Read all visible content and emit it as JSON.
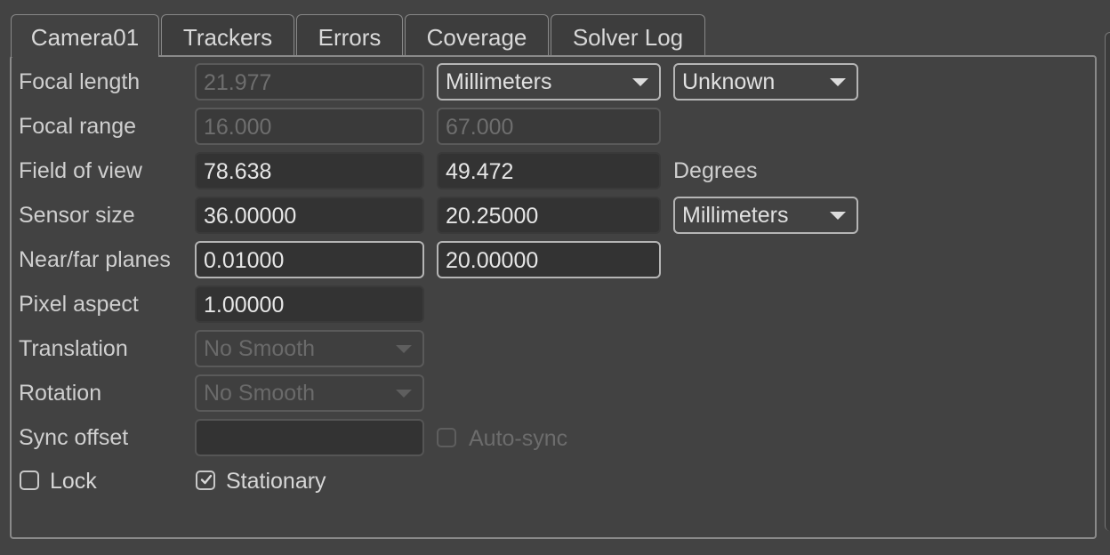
{
  "tabs": [
    {
      "label": "Camera01"
    },
    {
      "label": "Trackers"
    },
    {
      "label": "Errors"
    },
    {
      "label": "Coverage"
    },
    {
      "label": "Solver Log"
    }
  ],
  "rows": {
    "focal_length": {
      "label": "Focal length",
      "value": "21.977",
      "unit": "Millimeters",
      "mode": "Unknown"
    },
    "focal_range": {
      "label": "Focal range",
      "min": "16.000",
      "max": "67.000"
    },
    "field_of_view": {
      "label": "Field of view",
      "h": "78.638",
      "v": "49.472",
      "unit": "Degrees"
    },
    "sensor_size": {
      "label": "Sensor size",
      "w": "36.00000",
      "h": "20.25000",
      "unit": "Millimeters"
    },
    "near_far": {
      "label": "Near/far planes",
      "near": "0.01000",
      "far": "20.00000"
    },
    "pixel_aspect": {
      "label": "Pixel aspect",
      "value": "1.00000"
    },
    "translation": {
      "label": "Translation",
      "value": "No Smooth"
    },
    "rotation": {
      "label": "Rotation",
      "value": "No Smooth"
    },
    "sync_offset": {
      "label": "Sync offset",
      "value": "",
      "auto_sync_label": "Auto-sync",
      "auto_sync_checked": false
    }
  },
  "checkboxes": {
    "lock": {
      "label": "Lock",
      "checked": false
    },
    "stationary": {
      "label": "Stationary",
      "checked": true
    }
  }
}
